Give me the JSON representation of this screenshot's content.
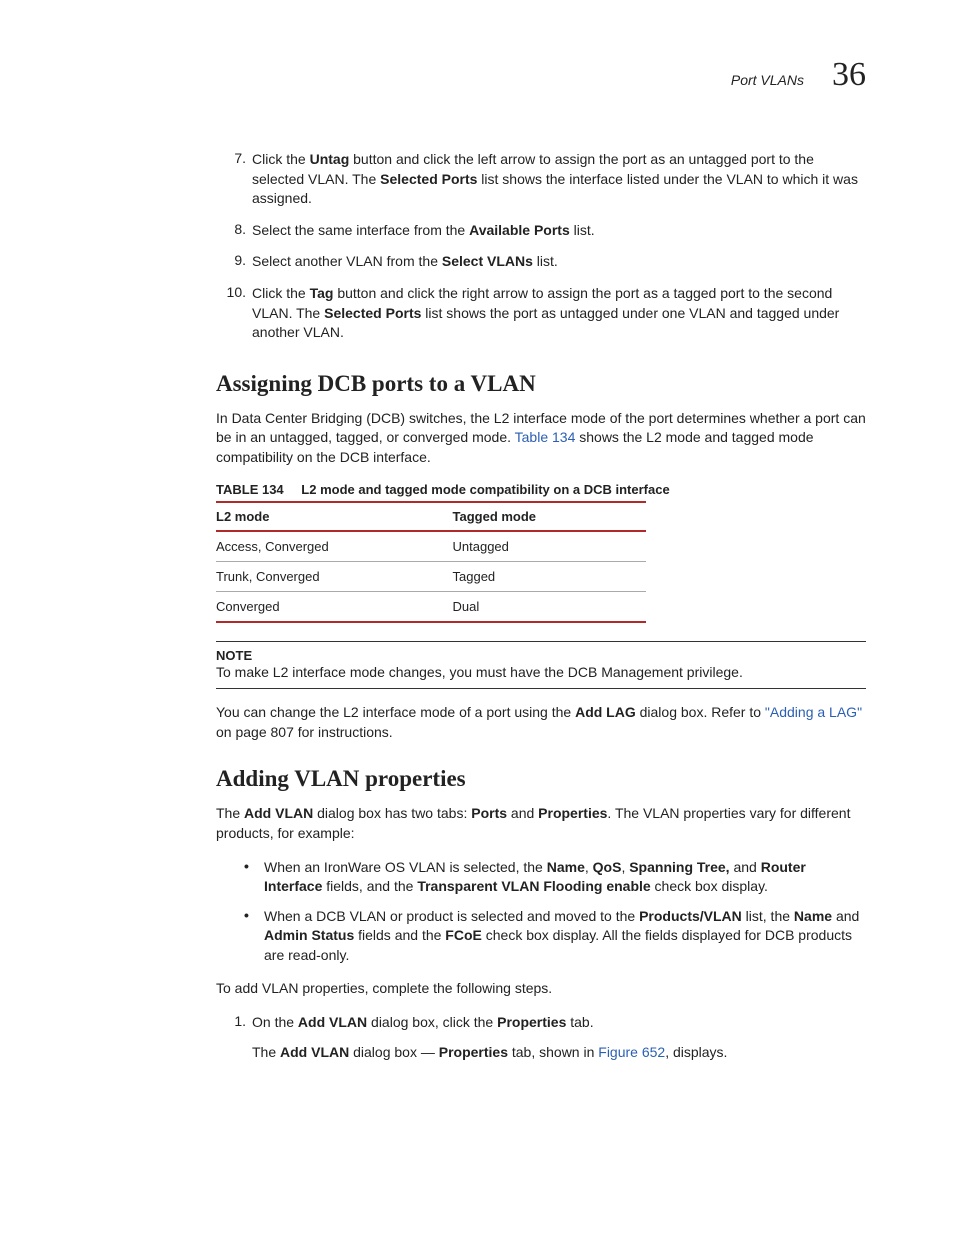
{
  "header": {
    "section_title": "Port VLANs",
    "chapter_number": "36"
  },
  "steps_a": {
    "s7": {
      "num": "7.",
      "t1": "Click the ",
      "b1": "Untag",
      "t2": " button and click the left arrow to assign the port as an untagged port to the selected VLAN. The ",
      "b2": "Selected Ports",
      "t3": " list shows the interface listed under the VLAN to which it was assigned."
    },
    "s8": {
      "num": "8.",
      "t1": "Select the same interface from the ",
      "b1": "Available Ports",
      "t2": " list."
    },
    "s9": {
      "num": "9.",
      "t1": "Select another VLAN from the ",
      "b1": "Select VLANs",
      "t2": " list."
    },
    "s10": {
      "num": "10.",
      "t1": "Click the ",
      "b1": "Tag",
      "t2": " button and click the right arrow to assign the port as a tagged port to the second VLAN. The ",
      "b2": "Selected Ports",
      "t3": " list shows the port as untagged under one VLAN and tagged under another VLAN."
    }
  },
  "section1": {
    "heading": "Assigning DCB ports to a VLAN",
    "p1_a": "In Data Center Bridging (DCB) switches, the L2 interface mode of the port determines whether a port can be in an untagged, tagged, or converged mode. ",
    "p1_link": "Table 134",
    "p1_b": " shows the L2 mode and tagged mode compatibility on the DCB interface."
  },
  "table": {
    "label": "TABLE 134",
    "caption": "L2 mode and tagged mode compatibility on a DCB interface",
    "headers": {
      "c1": "L2 mode",
      "c2": "Tagged mode"
    },
    "rows": [
      {
        "c1": "Access, Converged",
        "c2": "Untagged"
      },
      {
        "c1": "Trunk, Converged",
        "c2": "Tagged"
      },
      {
        "c1": "Converged",
        "c2": "Dual"
      }
    ]
  },
  "note": {
    "label": "NOTE",
    "text": "To make L2 interface mode changes, you must have the DCB Management privilege."
  },
  "section1b": {
    "p2_a": "You can change the L2 interface mode of a port using the ",
    "p2_b1": "Add LAG",
    "p2_b": " dialog box. Refer to ",
    "p2_link": "\"Adding a LAG\"",
    "p2_c": " on page 807 for instructions."
  },
  "section2": {
    "heading": "Adding VLAN properties",
    "p1_a": "The ",
    "p1_b1": "Add VLAN",
    "p1_b": " dialog box has two tabs: ",
    "p1_b2": "Ports",
    "p1_c": " and ",
    "p1_b3": "Properties",
    "p1_d": ". The VLAN properties vary for different products, for example:",
    "bullets": {
      "b1": {
        "a": "When an IronWare OS VLAN is selected, the ",
        "b1": "Name",
        "c1": ", ",
        "b2": "QoS",
        "c2": ", ",
        "b3": "Spanning Tree,",
        "c3": " and ",
        "b4": "Router Interface",
        "d": " fields, and the ",
        "b5": "Transparent VLAN Flooding enable",
        "e": " check box display."
      },
      "b2": {
        "a": "When a DCB VLAN or product is selected and moved to the ",
        "b1": "Products/VLAN",
        "c1": " list, the ",
        "b2": "Name",
        "c2": " and ",
        "b3": "Admin Status",
        "c3": " fields and the ",
        "b4": "FCoE",
        "d": " check box display. All the fields displayed for DCB products are read-only."
      }
    },
    "p2": "To add VLAN properties, complete the following steps.",
    "step1": {
      "num": "1.",
      "a": "On the ",
      "b1": "Add VLAN",
      "b": " dialog box, click the ",
      "b2": "Properties",
      "c": " tab.",
      "sub_a": "The ",
      "sub_b1": "Add VLAN",
      "sub_b": " dialog box — ",
      "sub_b2": "Properties",
      "sub_c": " tab, shown in ",
      "sub_link": "Figure 652",
      "sub_d": ", displays."
    }
  }
}
